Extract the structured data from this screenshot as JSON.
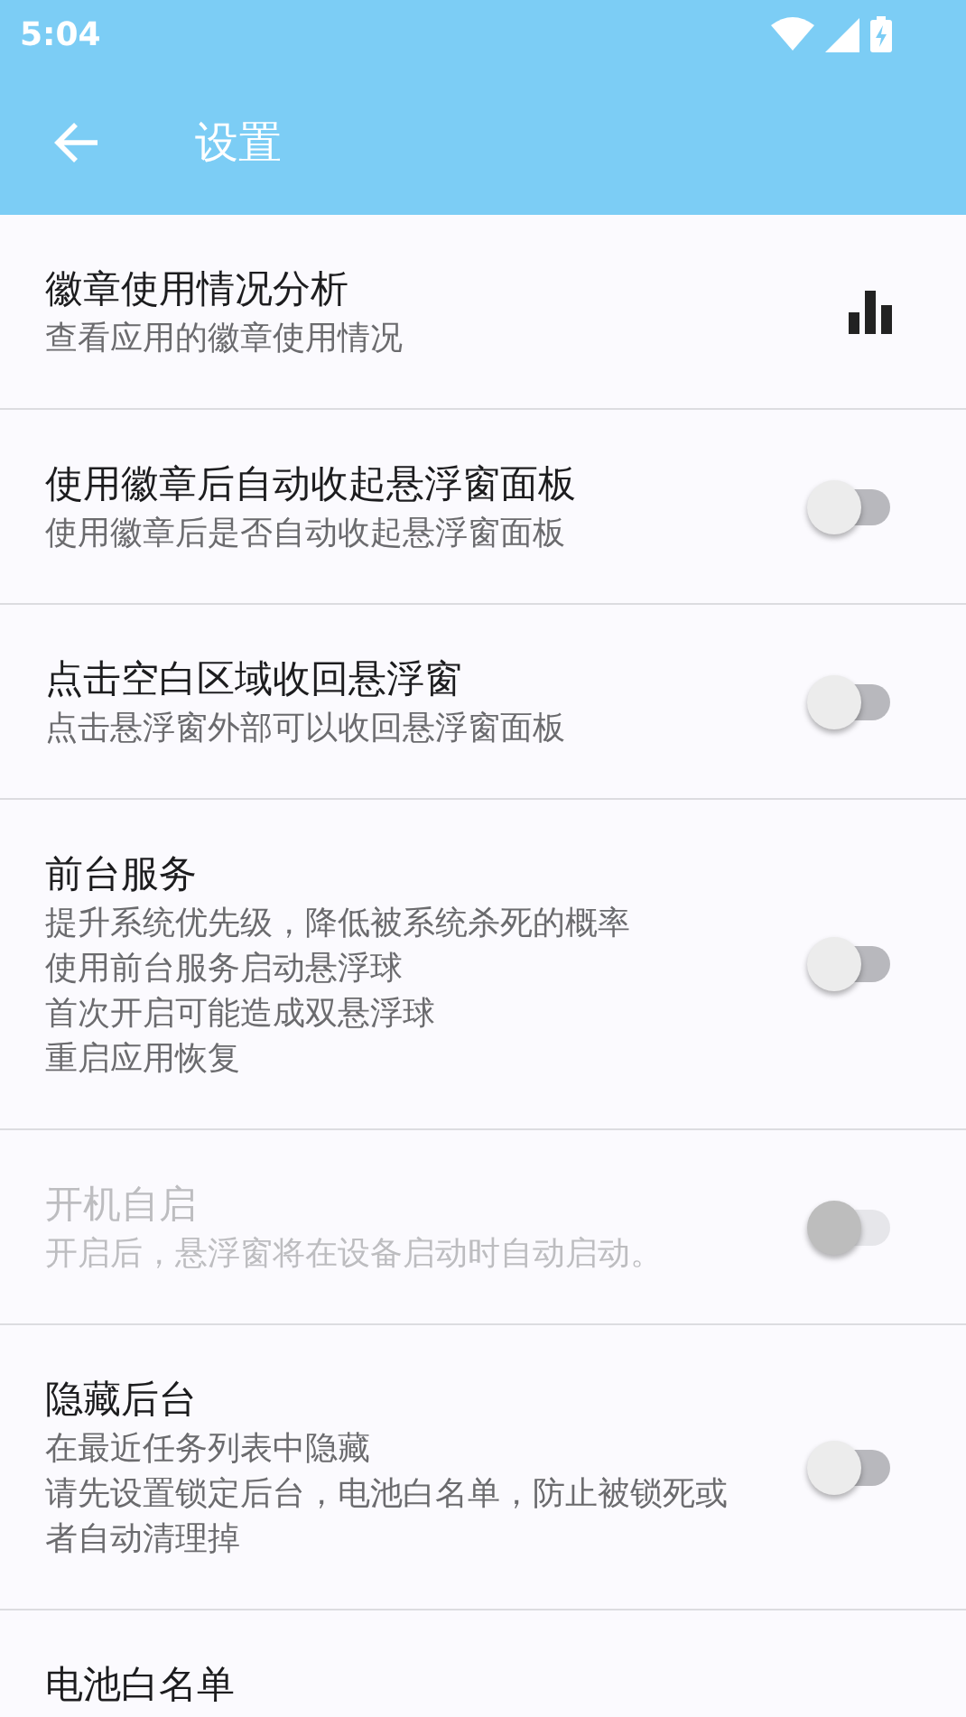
{
  "status_bar": {
    "time": "5:04"
  },
  "app_bar": {
    "title": "设置"
  },
  "settings": [
    {
      "kind": "chart",
      "title": "徽章使用情况分析",
      "summary": [
        "查看应用的徽章使用情况"
      ],
      "enabled": true
    },
    {
      "kind": "switch",
      "title": "使用徽章后自动收起悬浮窗面板",
      "summary": [
        "使用徽章后是否自动收起悬浮窗面板"
      ],
      "enabled": true,
      "on": false
    },
    {
      "kind": "switch",
      "title": "点击空白区域收回悬浮窗",
      "summary": [
        "点击悬浮窗外部可以收回悬浮窗面板"
      ],
      "enabled": true,
      "on": false
    },
    {
      "kind": "switch",
      "title": "前台服务",
      "summary": [
        "提升系统优先级，降低被系统杀死的概率",
        "使用前台服务启动悬浮球",
        "首次开启可能造成双悬浮球",
        "重启应用恢复"
      ],
      "enabled": true,
      "on": false
    },
    {
      "kind": "switch",
      "title": "开机自启",
      "summary": [
        "开启后，悬浮窗将在设备启动时自动启动。"
      ],
      "enabled": false,
      "on": false
    },
    {
      "kind": "switch",
      "title": "隐藏后台",
      "summary": [
        "在最近任务列表中隐藏",
        "请先设置锁定后台，电池白名单，防止被锁死或者自动清理掉"
      ],
      "enabled": true,
      "on": false
    },
    {
      "kind": "plain",
      "title": "电池白名单",
      "enabled": true
    }
  ]
}
